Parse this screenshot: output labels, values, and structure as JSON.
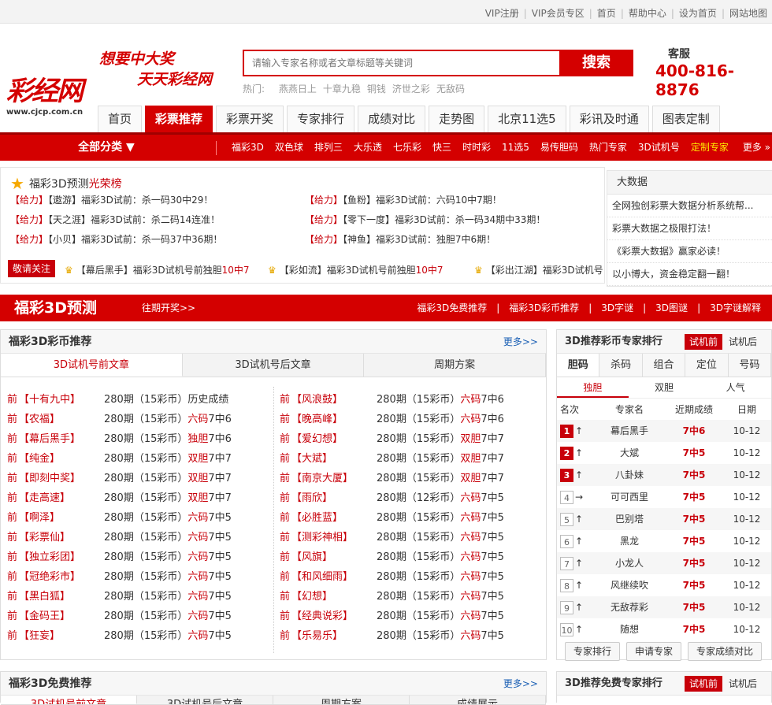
{
  "topbar": {
    "links": [
      "VIP注册",
      "VIP会员专区",
      "首页",
      "帮助中心",
      "设为首页",
      "网站地图"
    ]
  },
  "logo": {
    "mark": "彩经网",
    "url": "www.cjcp.com.cn"
  },
  "slogan": {
    "line1": "想要中大奖",
    "line2": "天天彩经网"
  },
  "search": {
    "placeholder": "请输入专家名称或者文章标题等关键词",
    "button": "搜索",
    "hot_label": "热门:",
    "hot_words": [
      "燕燕日上",
      "十章九稳",
      "铜钱",
      "济世之彩",
      "无敌码"
    ]
  },
  "service": {
    "label": "客服",
    "phone": "400-816-8876"
  },
  "navtabs": [
    "首页",
    "彩票推荐",
    "彩票开奖",
    "专家排行",
    "成绩对比",
    "走势图",
    "北京11选5",
    "彩讯及时通",
    "图表定制"
  ],
  "subnav": {
    "all_label": "全部分类 ▼",
    "items": [
      "福彩3D",
      "双色球",
      "排列三",
      "大乐透",
      "七乐彩",
      "快三",
      "时时彩",
      "11选5",
      "易传胆码",
      "热门专家",
      "3D试机号",
      "定制专家"
    ],
    "more": "更多 »"
  },
  "honor": {
    "title": "福彩3D预测",
    "title_hl": "光荣榜",
    "rows_left": [
      {
        "tag": "【给力】",
        "text": "【遨游】福彩3D试前：杀一码30中29！"
      },
      {
        "tag": "【给力】",
        "text": "【天之涯】福彩3D试前：杀二码14连准！"
      },
      {
        "tag": "【给力】",
        "text": "【小贝】福彩3D试前：杀一码37中36期！"
      }
    ],
    "rows_right": [
      {
        "tag": "【给力】",
        "text": "【鱼粉】福彩3D试前：六码10中7期！"
      },
      {
        "tag": "【给力】",
        "text": "【零下一度】福彩3D试前：杀一码34期中33期！"
      },
      {
        "tag": "【给力】",
        "text": "【神鱼】福彩3D试前：独胆7中6期！"
      }
    ],
    "follow": "敬请关注",
    "marquee": [
      {
        "text": "【幕后黑手】福彩3D试机号前独胆",
        "hl": "10中7"
      },
      {
        "text": "【彩如流】福彩3D试机号前独胆",
        "hl": "10中7"
      },
      {
        "text": "【彩出江湖】福彩3D试机号",
        "hl": ""
      }
    ]
  },
  "bigdata": {
    "title": "大数据",
    "items": [
      "全网独创彩票大数据分析系统帮...",
      "彩票大数据之极限打法！",
      "《彩票大数据》赢家必读！",
      "以小博大，资金稳定翻一翻！"
    ]
  },
  "section": {
    "name": "福彩3D预测",
    "past": "往期开奖>>",
    "links": [
      "福彩3D免费推荐",
      "福彩3D彩币推荐",
      "3D字谜",
      "3D图谜",
      "3D字谜解释"
    ]
  },
  "coin_panel": {
    "title": "福彩3D彩币推荐",
    "more": "更多>>",
    "tabs": [
      "3D试机号前文章",
      "3D试机号后文章",
      "周期方案"
    ],
    "left_rows": [
      {
        "pre": "前",
        "name": "【十有九中】",
        "info": "280期（15彩币）",
        "hl": "",
        "tail": "历史成绩"
      },
      {
        "pre": "前",
        "name": "【农福】",
        "info": "280期（15彩币）",
        "hl": "六码",
        "tail": "7中6"
      },
      {
        "pre": "前",
        "name": "【幕后黑手】",
        "info": "280期（15彩币）",
        "hl": "独胆",
        "tail": "7中6"
      },
      {
        "pre": "前",
        "name": "【纯金】",
        "info": "280期（15彩币）",
        "hl": "双胆",
        "tail": "7中7"
      },
      {
        "pre": "前",
        "name": "【即刻中奖】",
        "info": "280期（15彩币）",
        "hl": "双胆",
        "tail": "7中7"
      },
      {
        "pre": "前",
        "name": "【走高速】",
        "info": "280期（15彩币）",
        "hl": "双胆",
        "tail": "7中7"
      },
      {
        "pre": "前",
        "name": "【啊泽】",
        "info": "280期（15彩币）",
        "hl": "六码",
        "tail": "7中5"
      },
      {
        "pre": "前",
        "name": "【彩票仙】",
        "info": "280期（15彩币）",
        "hl": "六码",
        "tail": "7中5"
      },
      {
        "pre": "前",
        "name": "【独立彩团】",
        "info": "280期（15彩币）",
        "hl": "六码",
        "tail": "7中5"
      },
      {
        "pre": "前",
        "name": "【冠绝彩市】",
        "info": "280期（15彩币）",
        "hl": "六码",
        "tail": "7中5"
      },
      {
        "pre": "前",
        "name": "【黑白狐】",
        "info": "280期（15彩币）",
        "hl": "六码",
        "tail": "7中5"
      },
      {
        "pre": "前",
        "name": "【金码王】",
        "info": "280期（15彩币）",
        "hl": "六码",
        "tail": "7中5"
      },
      {
        "pre": "前",
        "name": "【狂妄】",
        "info": "280期（15彩币）",
        "hl": "六码",
        "tail": "7中5"
      }
    ],
    "right_rows": [
      {
        "pre": "前",
        "name": "【风浪鼓】",
        "info": "280期（15彩币）",
        "hl": "六码",
        "tail": "7中6"
      },
      {
        "pre": "前",
        "name": "【晚高峰】",
        "info": "280期（15彩币）",
        "hl": "六码",
        "tail": "7中6"
      },
      {
        "pre": "前",
        "name": "【爱幻想】",
        "info": "280期（15彩币）",
        "hl": "双胆",
        "tail": "7中7"
      },
      {
        "pre": "前",
        "name": "【大斌】",
        "info": "280期（15彩币）",
        "hl": "双胆",
        "tail": "7中7"
      },
      {
        "pre": "前",
        "name": "【南京大厦】",
        "info": "280期（15彩币）",
        "hl": "双胆",
        "tail": "7中7"
      },
      {
        "pre": "前",
        "name": "【雨欣】",
        "info": "280期（12彩币）",
        "hl": "六码",
        "tail": "7中5"
      },
      {
        "pre": "前",
        "name": "【必胜蓝】",
        "info": "280期（15彩币）",
        "hl": "六码",
        "tail": "7中5"
      },
      {
        "pre": "前",
        "name": "【测彩神相】",
        "info": "280期（15彩币）",
        "hl": "六码",
        "tail": "7中5"
      },
      {
        "pre": "前",
        "name": "【风旗】",
        "info": "280期（15彩币）",
        "hl": "六码",
        "tail": "7中5"
      },
      {
        "pre": "前",
        "name": "【和风细雨】",
        "info": "280期（15彩币）",
        "hl": "六码",
        "tail": "7中5"
      },
      {
        "pre": "前",
        "name": "【幻想】",
        "info": "280期（15彩币）",
        "hl": "六码",
        "tail": "7中5"
      },
      {
        "pre": "前",
        "name": "【经典说彩】",
        "info": "280期（15彩币）",
        "hl": "六码",
        "tail": "7中5"
      },
      {
        "pre": "前",
        "name": "【乐易乐】",
        "info": "280期（15彩币）",
        "hl": "六码",
        "tail": "7中5"
      }
    ]
  },
  "rank_panel": {
    "title": "3D推荐彩币专家排行",
    "toggle_on": "试机前",
    "toggle_off": "试机后",
    "cat_tabs": [
      "胆码",
      "杀码",
      "组合",
      "定位",
      "号码"
    ],
    "sub_tabs": [
      "独胆",
      "双胆",
      "人气"
    ],
    "headers": [
      "名次",
      "专家名",
      "近期成绩",
      "日期"
    ],
    "rows": [
      {
        "rank": "1",
        "trend": "↑",
        "name": "幕后黑手",
        "score": "7中6",
        "date": "10-12"
      },
      {
        "rank": "2",
        "trend": "↑",
        "name": "大斌",
        "score": "7中5",
        "date": "10-12"
      },
      {
        "rank": "3",
        "trend": "↑",
        "name": "八卦妹",
        "score": "7中5",
        "date": "10-12"
      },
      {
        "rank": "4",
        "trend": "→",
        "name": "可可西里",
        "score": "7中5",
        "date": "10-12"
      },
      {
        "rank": "5",
        "trend": "↑",
        "name": "巴别塔",
        "score": "7中5",
        "date": "10-12"
      },
      {
        "rank": "6",
        "trend": "↑",
        "name": "黑龙",
        "score": "7中5",
        "date": "10-12"
      },
      {
        "rank": "7",
        "trend": "↑",
        "name": "小龙人",
        "score": "7中5",
        "date": "10-12"
      },
      {
        "rank": "8",
        "trend": "↑",
        "name": "风继续吹",
        "score": "7中5",
        "date": "10-12"
      },
      {
        "rank": "9",
        "trend": "↑",
        "name": "无敌荐彩",
        "score": "7中5",
        "date": "10-12"
      },
      {
        "rank": "10",
        "trend": "↑",
        "name": "随想",
        "score": "7中5",
        "date": "10-12"
      }
    ],
    "buttons": [
      "专家排行",
      "申请专家",
      "专家成绩对比"
    ]
  },
  "free_panel": {
    "title": "福彩3D免费推荐",
    "more": "更多>>",
    "tabs": [
      "3D试机号前文章",
      "3D试机号后文章",
      "周期方案",
      "成绩展示"
    ]
  },
  "free_rank": {
    "title": "3D推荐免费专家排行",
    "toggle_on": "试机前",
    "toggle_off": "试机后"
  }
}
